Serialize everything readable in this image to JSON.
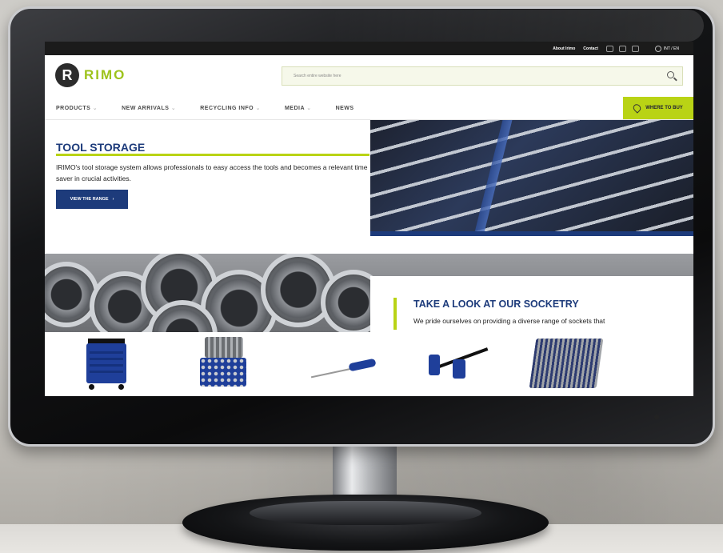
{
  "topbar": {
    "about_label": "About Irimo",
    "contact_label": "Contact",
    "language_label": "INT / EN"
  },
  "header": {
    "logo_mark": "R",
    "logo_text": "RIMO",
    "search_placeholder": "Search entire website here"
  },
  "nav": {
    "items": [
      {
        "label": "PRODUCTS"
      },
      {
        "label": "NEW ARRIVALS"
      },
      {
        "label": "RECYCLING INFO"
      },
      {
        "label": "MEDIA"
      },
      {
        "label": "NEWS"
      }
    ],
    "where_to_buy": "WHERE TO BUY"
  },
  "hero": {
    "title": "TOOL STORAGE",
    "text": "IRIMO's tool storage system allows professionals to easy access the tools and becomes a relevant time saver in crucial activities.",
    "button_label": "VIEW THE RANGE"
  },
  "socketry": {
    "title": "TAKE A LOOK AT OUR SOCKETRY",
    "text": "We pride ourselves on providing a diverse range of sockets that"
  },
  "colors": {
    "brand_blue": "#1d3b7b",
    "brand_green": "#b9d315",
    "topbar": "#1b1b1b"
  },
  "icons": [
    "facebook-icon",
    "youtube-icon",
    "instagram-icon",
    "globe-icon",
    "search-icon",
    "chevron-down-icon",
    "location-pin-icon"
  ]
}
